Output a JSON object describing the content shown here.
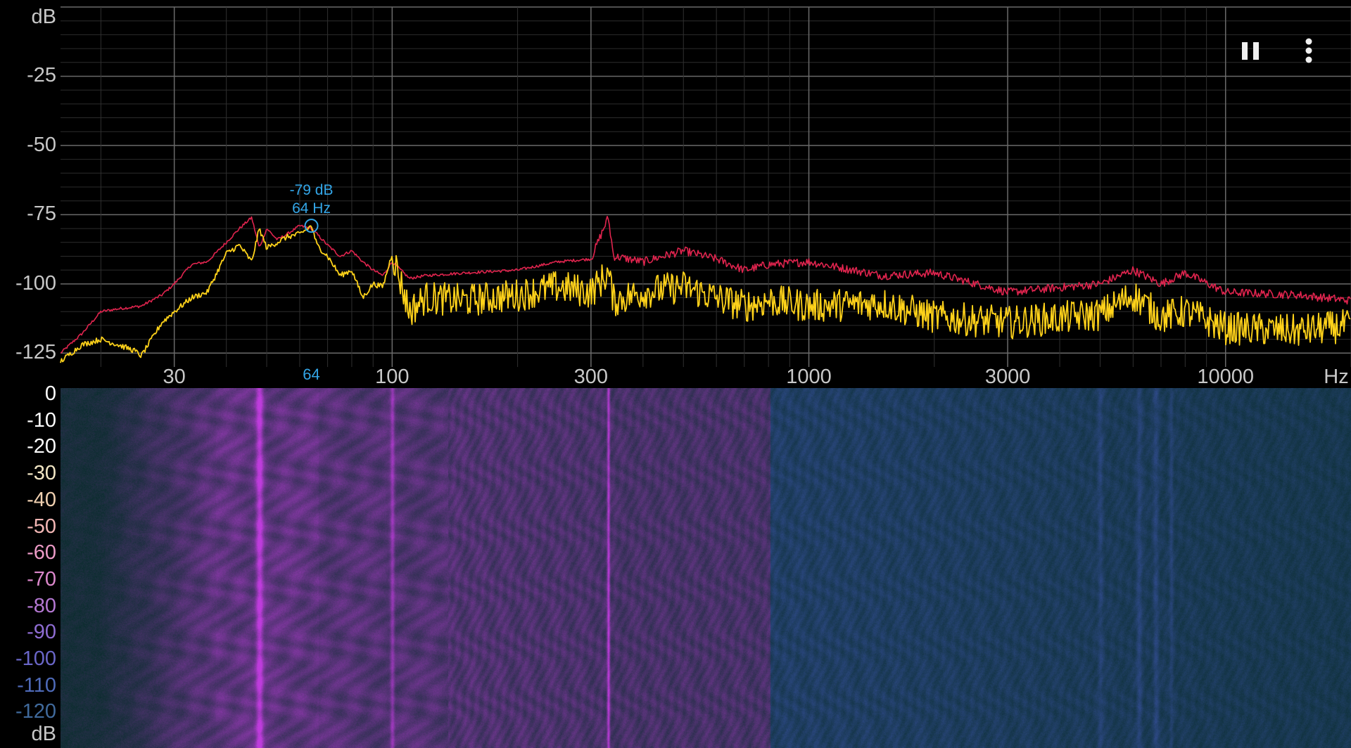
{
  "spectrum": {
    "y_unit": "dB",
    "x_unit": "Hz",
    "y_ticks": [
      {
        "value": -25,
        "label": "-25"
      },
      {
        "value": -50,
        "label": "-50"
      },
      {
        "value": -75,
        "label": "-75"
      },
      {
        "value": -100,
        "label": "-100"
      },
      {
        "value": -125,
        "label": "-125"
      }
    ],
    "x_ticks": [
      {
        "value": 30,
        "label": "30"
      },
      {
        "value": 100,
        "label": "100"
      },
      {
        "value": 300,
        "label": "300"
      },
      {
        "value": 1000,
        "label": "1000"
      },
      {
        "value": 3000,
        "label": "3000"
      },
      {
        "value": 10000,
        "label": "10000"
      }
    ],
    "marker": {
      "db_label": "-79 dB",
      "freq_label": "64 Hz",
      "tick_label": "64",
      "freq": 64,
      "db": -79
    }
  },
  "spectrogram": {
    "scale_unit": "dB",
    "scale_ticks": [
      "0",
      "-10",
      "-20",
      "-30",
      "-40",
      "-50",
      "-60",
      "-70",
      "-80",
      "-90",
      "-100",
      "-110",
      "-120"
    ],
    "scale_colors": [
      "#ffffff",
      "#ffffff",
      "#ffffff",
      "#f2e6c4",
      "#f0d0b0",
      "#f2b6b4",
      "#ec9ac6",
      "#dc88cc",
      "#b478d2",
      "#8e6cd2",
      "#6a66c8",
      "#4e6ab8",
      "#406a9c"
    ]
  },
  "chart_data": {
    "type": "line",
    "xlabel": "Hz",
    "ylabel": "dB",
    "x_scale": "log",
    "xlim": [
      16,
      20000
    ],
    "ylim": [
      -130,
      0
    ],
    "grid": true,
    "series": [
      {
        "color": "#e0244e",
        "x": [
          16,
          18,
          20,
          22,
          25,
          28,
          30,
          33,
          36,
          40,
          43,
          46,
          48,
          50,
          53,
          56,
          60,
          64,
          66,
          70,
          75,
          80,
          85,
          90,
          95,
          100,
          110,
          120,
          150,
          200,
          250,
          300,
          330,
          340,
          400,
          500,
          600,
          700,
          800,
          1000,
          1500,
          2000,
          3000,
          5000,
          6000,
          7000,
          8000,
          10000,
          15000,
          20000
        ],
        "values": [
          -125,
          -118,
          -110,
          -109,
          -108,
          -104,
          -100,
          -93,
          -92,
          -85,
          -80,
          -76,
          -87,
          -80,
          -84,
          -82,
          -79,
          -80,
          -82,
          -86,
          -90,
          -88,
          -92,
          -95,
          -97,
          -92,
          -98,
          -97,
          -96,
          -95,
          -92,
          -91,
          -76,
          -90,
          -92,
          -88,
          -91,
          -95,
          -93,
          -92,
          -97,
          -96,
          -103,
          -100,
          -95,
          -100,
          -96,
          -103,
          -104,
          -106
        ]
      },
      {
        "color": "#ffd21a",
        "x": [
          16,
          18,
          20,
          22,
          24,
          25,
          28,
          30,
          33,
          36,
          40,
          43,
          46,
          48,
          50,
          53,
          56,
          60,
          64,
          66,
          70,
          75,
          80,
          85,
          90,
          95,
          100,
          110,
          120,
          150,
          200,
          250,
          300,
          330,
          340,
          400,
          500,
          600,
          700,
          800,
          1000,
          1500,
          2000,
          3000,
          5000,
          6000,
          7000,
          8000,
          10000,
          15000,
          20000
        ],
        "values": [
          -128,
          -122,
          -120,
          -122,
          -124,
          -126,
          -114,
          -110,
          -105,
          -103,
          -89,
          -86,
          -92,
          -80,
          -87,
          -85,
          -83,
          -82,
          -79,
          -86,
          -90,
          -97,
          -95,
          -105,
          -100,
          -101,
          -89,
          -110,
          -105,
          -106,
          -104,
          -101,
          -103,
          -96,
          -106,
          -103,
          -101,
          -105,
          -108,
          -106,
          -108,
          -107,
          -112,
          -114,
          -111,
          -104,
          -112,
          -110,
          -116,
          -117,
          -115
        ]
      }
    ]
  }
}
